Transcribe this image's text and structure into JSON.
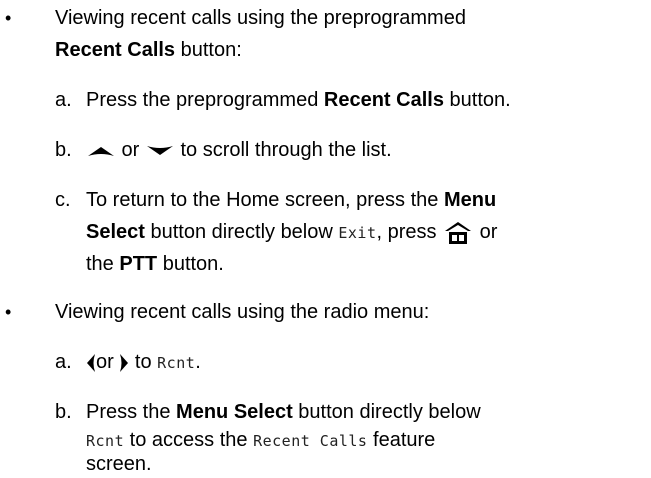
{
  "section1": {
    "bullet": "•",
    "intro_text": "Viewing recent calls using the preprogrammed",
    "intro_bold": "Recent Calls",
    "intro_suffix": " button:",
    "steps": [
      {
        "letter": "a.",
        "pre": "Press the preprogrammed ",
        "bold": "Recent Calls",
        "post": " button."
      },
      {
        "letter": "b.",
        "or": " or ",
        "post": " to scroll through the list."
      },
      {
        "letter": "c.",
        "pre": "To return to the Home screen, press the ",
        "bold1": "Menu",
        "bold2": "Select",
        "mid": " button directly below ",
        "lcd": "Exit",
        "post": ", press ",
        "or": " or",
        "line3_pre": "the ",
        "line3_bold": "PTT",
        "line3_post": " button."
      }
    ]
  },
  "section2": {
    "bullet": "•",
    "intro_text": "Viewing recent calls using the radio menu:",
    "steps": [
      {
        "letter": "a.",
        "or": "or ",
        "to": " to ",
        "lcd": "Rcnt",
        "post": "."
      },
      {
        "letter": "b.",
        "pre": "Press the ",
        "bold": "Menu Select",
        "post": " button directly below",
        "lcd1": "Rcnt",
        "mid": " to access the ",
        "lcd2": "Recent Calls",
        "post2": " feature",
        "line3": "screen."
      }
    ]
  },
  "colors": {
    "text": "#000000",
    "lcd_text": "#222222"
  },
  "icons": [
    "up-arrow-icon",
    "down-arrow-icon",
    "home-icon",
    "left-arrow-icon",
    "right-arrow-icon"
  ]
}
